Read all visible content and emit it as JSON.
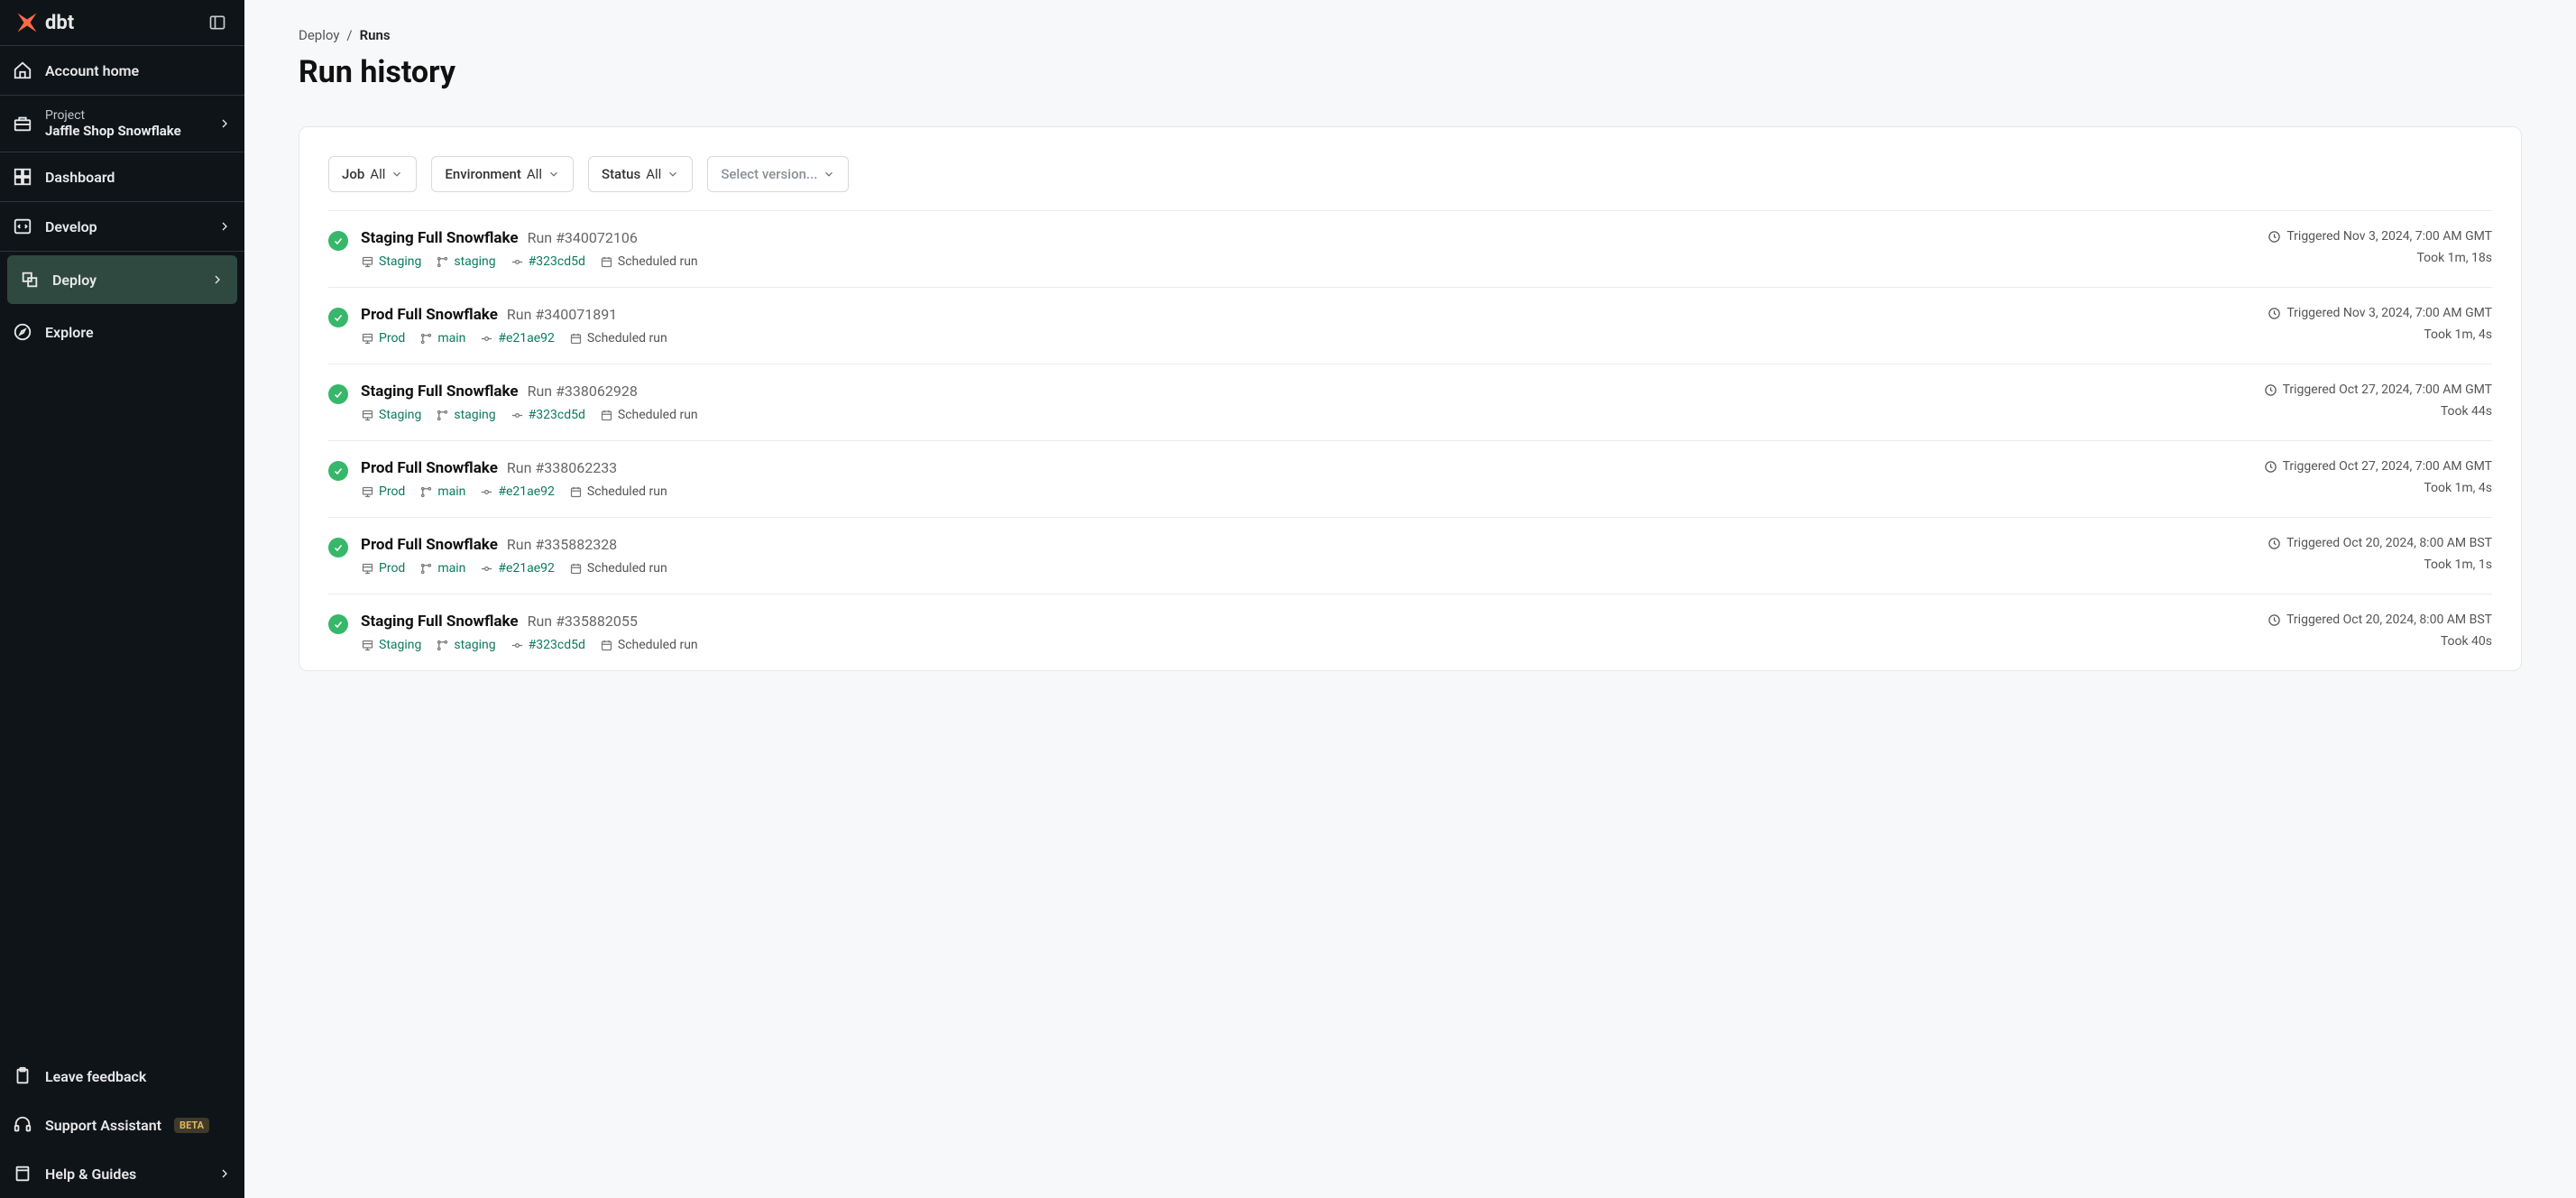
{
  "brand": {
    "name": "dbt"
  },
  "sidebar": {
    "account_home": "Account home",
    "project_label": "Project",
    "project_name": "Jaffle Shop Snowflake",
    "items": [
      {
        "label": "Dashboard"
      },
      {
        "label": "Develop"
      },
      {
        "label": "Deploy"
      },
      {
        "label": "Explore"
      }
    ],
    "bottom": {
      "feedback": "Leave feedback",
      "support": "Support Assistant",
      "support_badge": "BETA",
      "help": "Help & Guides"
    }
  },
  "breadcrumb": {
    "deploy": "Deploy",
    "separator": "/",
    "runs": "Runs"
  },
  "page": {
    "title": "Run history"
  },
  "filters": {
    "job_label": "Job",
    "job_value": "All",
    "env_label": "Environment",
    "env_value": "All",
    "status_label": "Status",
    "status_value": "All",
    "version_placeholder": "Select version..."
  },
  "runs": [
    {
      "name": "Staging Full Snowflake",
      "run_number": "Run #340072106",
      "env": "Staging",
      "branch": "staging",
      "commit": "#323cd5d",
      "trigger_type": "Scheduled run",
      "triggered": "Triggered Nov 3, 2024, 7:00 AM GMT",
      "duration": "Took 1m, 18s"
    },
    {
      "name": "Prod Full Snowflake",
      "run_number": "Run #340071891",
      "env": "Prod",
      "branch": "main",
      "commit": "#e21ae92",
      "trigger_type": "Scheduled run",
      "triggered": "Triggered Nov 3, 2024, 7:00 AM GMT",
      "duration": "Took 1m, 4s"
    },
    {
      "name": "Staging Full Snowflake",
      "run_number": "Run #338062928",
      "env": "Staging",
      "branch": "staging",
      "commit": "#323cd5d",
      "trigger_type": "Scheduled run",
      "triggered": "Triggered Oct 27, 2024, 7:00 AM GMT",
      "duration": "Took 44s"
    },
    {
      "name": "Prod Full Snowflake",
      "run_number": "Run #338062233",
      "env": "Prod",
      "branch": "main",
      "commit": "#e21ae92",
      "trigger_type": "Scheduled run",
      "triggered": "Triggered Oct 27, 2024, 7:00 AM GMT",
      "duration": "Took 1m, 4s"
    },
    {
      "name": "Prod Full Snowflake",
      "run_number": "Run #335882328",
      "env": "Prod",
      "branch": "main",
      "commit": "#e21ae92",
      "trigger_type": "Scheduled run",
      "triggered": "Triggered Oct 20, 2024, 8:00 AM BST",
      "duration": "Took 1m, 1s"
    },
    {
      "name": "Staging Full Snowflake",
      "run_number": "Run #335882055",
      "env": "Staging",
      "branch": "staging",
      "commit": "#323cd5d",
      "trigger_type": "Scheduled run",
      "triggered": "Triggered Oct 20, 2024, 8:00 AM BST",
      "duration": "Took 40s"
    }
  ]
}
